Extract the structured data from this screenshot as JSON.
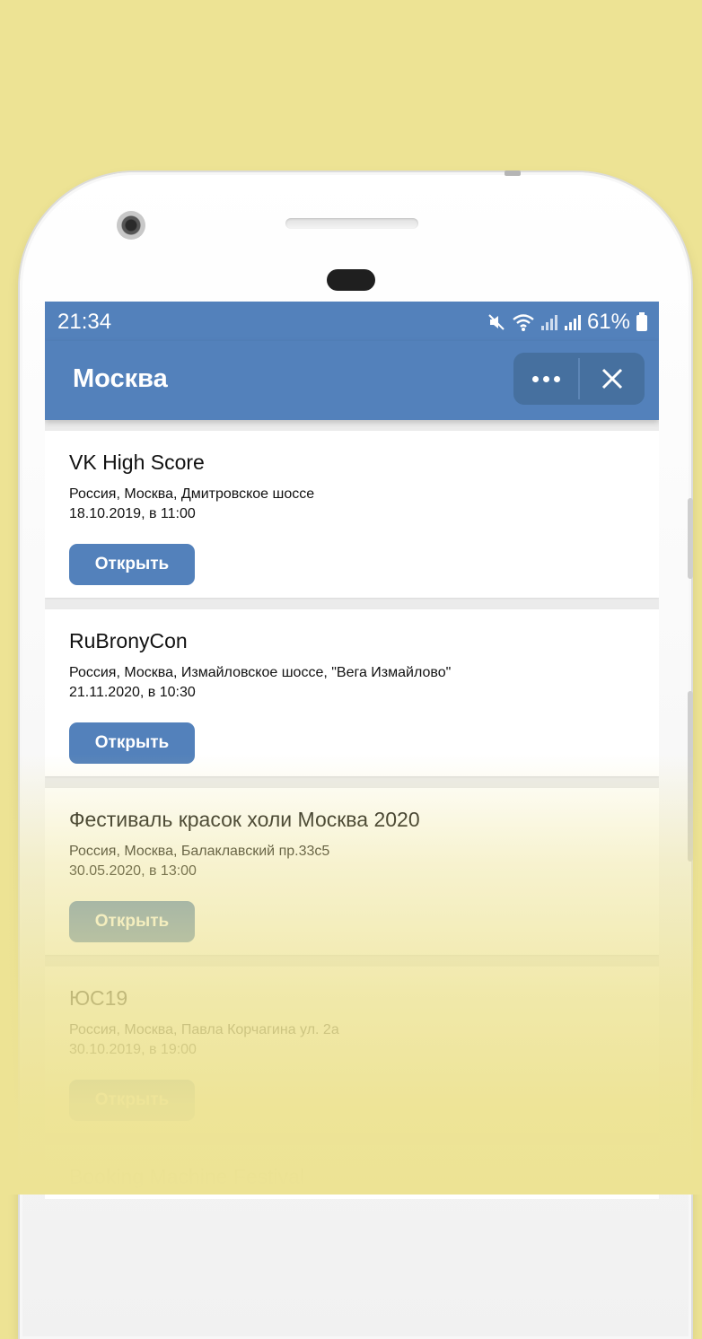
{
  "status_bar": {
    "time": "21:34",
    "battery": "61%",
    "icons": [
      "mute-icon",
      "wifi-icon",
      "signal-icon",
      "signal-icon",
      "battery-icon"
    ]
  },
  "header": {
    "title": "Москва",
    "more_icon": "more-dots-icon",
    "close_icon": "close-icon"
  },
  "events": [
    {
      "title": "VK High Score",
      "address": "Россия, Москва, Дмитровское шоссе",
      "date": "18.10.2019, в 11:00",
      "button": "Открыть"
    },
    {
      "title": "RuBronyCon",
      "address": "Россия, Москва, Измайловское шоссе, \"Вега Измайлово\"",
      "date": "21.11.2020, в 10:30",
      "button": "Открыть"
    },
    {
      "title": "Фестиваль красок холи Москва 2020",
      "address": "Россия, Москва, Балаклавский пр.33с5",
      "date": "30.05.2020, в 13:00",
      "button": "Открыть"
    },
    {
      "title": "ЮС19",
      "address": "Россия, Москва, Павла Корчагина ул. 2а",
      "date": "30.10.2019, в 19:00",
      "button": "Открыть"
    },
    {
      "title": "Booking Machine Festival",
      "address": "",
      "date": "",
      "button": ""
    }
  ],
  "colors": {
    "background": "#ede394",
    "accent": "#5381bb",
    "capsule": "#46709f"
  }
}
